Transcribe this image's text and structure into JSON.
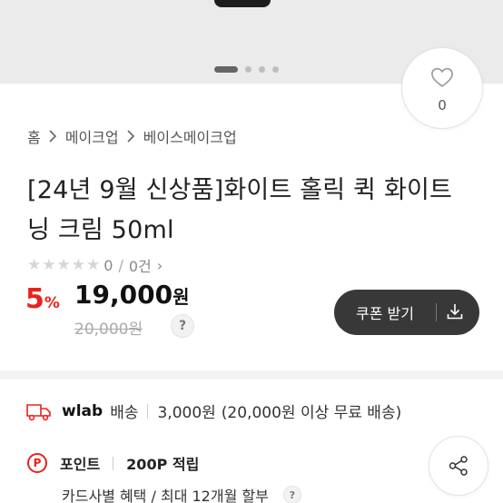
{
  "like": {
    "count": "0",
    "icon": "heart-icon"
  },
  "breadcrumb": [
    "홈",
    "메이크업",
    "베이스메이크업"
  ],
  "product": {
    "title": "[24년 9월 신상품]화이트 홀릭 퀵 화이트닝 크림 50ml",
    "rating": "0",
    "review_count": "0건",
    "discount": "5",
    "discount_unit": "%",
    "price": "19,000",
    "price_unit": "원",
    "original_price": "20,000원"
  },
  "coupon": {
    "label": "쿠폰 받기",
    "icon": "download-icon"
  },
  "shipping": {
    "brand": "wlab",
    "label": "배송",
    "fee": "3,000원",
    "condition": "(20,000원 이상 무료 배송)",
    "icon": "truck-icon"
  },
  "points": {
    "label": "포인트",
    "value": "200P 적립",
    "icon_text": "P"
  },
  "card": {
    "text": "카드사별 혜택 / 최대 12개월 할부"
  },
  "help_text": "?",
  "colors": {
    "accent": "#e8231c",
    "coupon_bg": "#383838"
  }
}
